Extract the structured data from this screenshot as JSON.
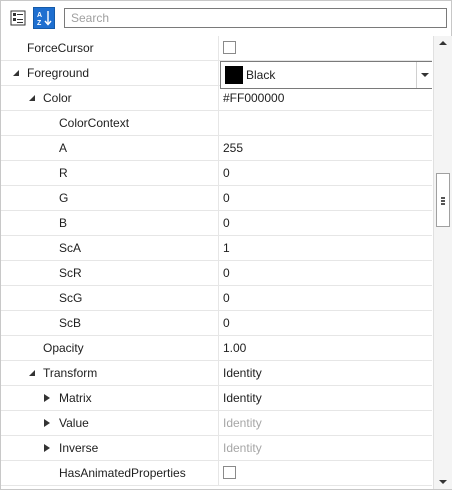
{
  "toolbar": {
    "categorized_icon": "categorized-view-icon",
    "alphabetical_icon": "sort-alphabetical-icon",
    "search_placeholder": "Search"
  },
  "colors": {
    "accent": "#1e6fd0",
    "grid_line": "#e6e6e6",
    "dim_text": "#a6a6a6"
  },
  "rows": [
    {
      "name": "ForceCursor",
      "value_type": "checkbox",
      "checked": false
    },
    {
      "name": "Foreground",
      "value": "Black",
      "value_type": "brush",
      "swatch_color": "#000000",
      "expanded": true
    },
    {
      "name": "Color",
      "value": "#FF000000",
      "expanded": true
    },
    {
      "name": "ColorContext",
      "value": ""
    },
    {
      "name": "A",
      "value": "255"
    },
    {
      "name": "R",
      "value": "0"
    },
    {
      "name": "G",
      "value": "0"
    },
    {
      "name": "B",
      "value": "0"
    },
    {
      "name": "ScA",
      "value": "1"
    },
    {
      "name": "ScR",
      "value": "0"
    },
    {
      "name": "ScG",
      "value": "0"
    },
    {
      "name": "ScB",
      "value": "0"
    },
    {
      "name": "Opacity",
      "value": "1.00"
    },
    {
      "name": "Transform",
      "value": "Identity",
      "expanded": true
    },
    {
      "name": "Matrix",
      "value": "Identity",
      "expanded": false
    },
    {
      "name": "Value",
      "value": "Identity",
      "expanded": false,
      "readonly": true
    },
    {
      "name": "Inverse",
      "value": "Identity",
      "expanded": false,
      "readonly": true
    },
    {
      "name": "HasAnimatedProperties",
      "value_type": "checkbox",
      "checked": false
    }
  ]
}
